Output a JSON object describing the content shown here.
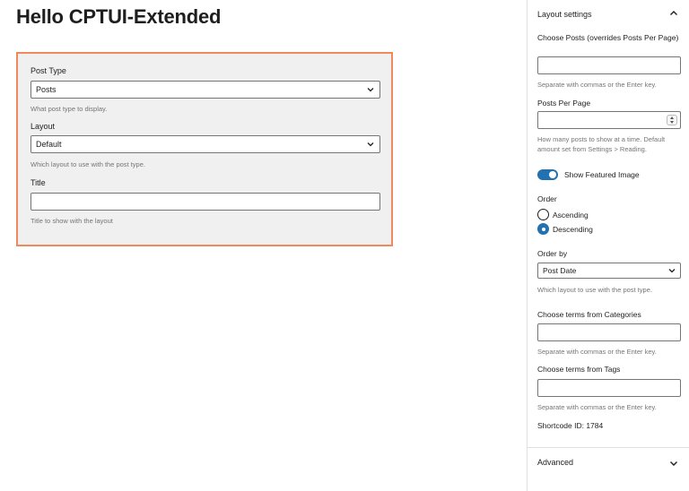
{
  "page": {
    "title": "Hello CPTUI-Extended"
  },
  "block": {
    "post_type": {
      "label": "Post Type",
      "value": "Posts",
      "help": "What post type to display."
    },
    "layout": {
      "label": "Layout",
      "value": "Default",
      "help": "Which layout to use with the post type."
    },
    "title": {
      "label": "Title",
      "value": "",
      "help": "Title to show with the layout"
    }
  },
  "sidebar": {
    "layout_settings": {
      "title": "Layout settings"
    },
    "choose_posts": {
      "label": "Choose Posts (overrides Posts Per Page)",
      "value": "",
      "help": "Separate with commas or the Enter key."
    },
    "posts_per_page": {
      "label": "Posts Per Page",
      "value": "",
      "help": "How many posts to show at a time. Default amount set from Settings > Reading."
    },
    "featured_image": {
      "label": "Show Featured Image",
      "enabled": true
    },
    "order": {
      "label": "Order",
      "options": [
        "Ascending",
        "Descending"
      ],
      "selected": "Descending"
    },
    "order_by": {
      "label": "Order by",
      "value": "Post Date",
      "help": "Which layout to use with the post type."
    },
    "categories": {
      "label": "Choose terms from Categories",
      "value": "",
      "help": "Separate with commas or the Enter key."
    },
    "tags": {
      "label": "Choose terms from Tags",
      "value": "",
      "help": "Separate with commas or the Enter key."
    },
    "shortcode": {
      "text": "Shortcode ID: 1784"
    },
    "advanced": {
      "title": "Advanced"
    }
  },
  "colors": {
    "accent": "#2271b1",
    "block_border": "#f08a5d",
    "block_bg": "#f0f0f0",
    "help_text": "#757575"
  },
  "icons": {
    "collapse": "chevron-up-icon",
    "expand": "chevron-down-icon"
  }
}
